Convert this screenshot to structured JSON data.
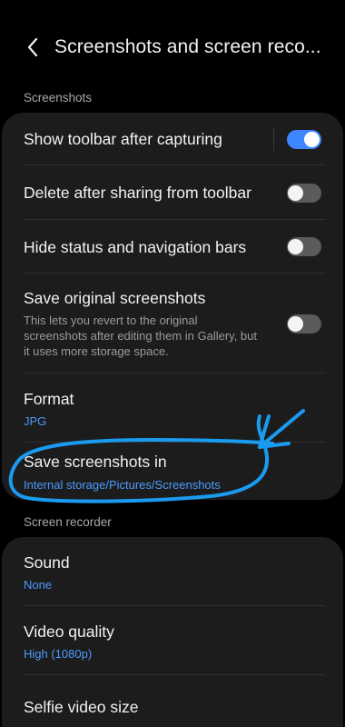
{
  "header": {
    "title": "Screenshots and screen reco...",
    "back_icon": "chevron-left"
  },
  "screenshots_section": {
    "label": "Screenshots",
    "items": [
      {
        "title": "Show toolbar after capturing",
        "toggle": "on"
      },
      {
        "title": "Delete after sharing from toolbar",
        "toggle": "off"
      },
      {
        "title": "Hide status and navigation bars",
        "toggle": "off"
      },
      {
        "title": "Save original screenshots",
        "description": "This lets you revert to the original screenshots after editing them in Gallery, but it uses more storage space.",
        "toggle": "off"
      },
      {
        "title": "Format",
        "value": "JPG"
      },
      {
        "title": "Save screenshots in",
        "value": "Internal storage/Pictures/Screenshots"
      }
    ]
  },
  "recorder_section": {
    "label": "Screen recorder",
    "items": [
      {
        "title": "Sound",
        "value": "None"
      },
      {
        "title": "Video quality",
        "value": "High (1080p)"
      },
      {
        "title": "Selfie video size"
      }
    ]
  },
  "colors": {
    "accent": "#3e87ff",
    "value_text": "#4c9bff",
    "annotation": "#1a9bf0",
    "card": "#1c1c1c"
  }
}
